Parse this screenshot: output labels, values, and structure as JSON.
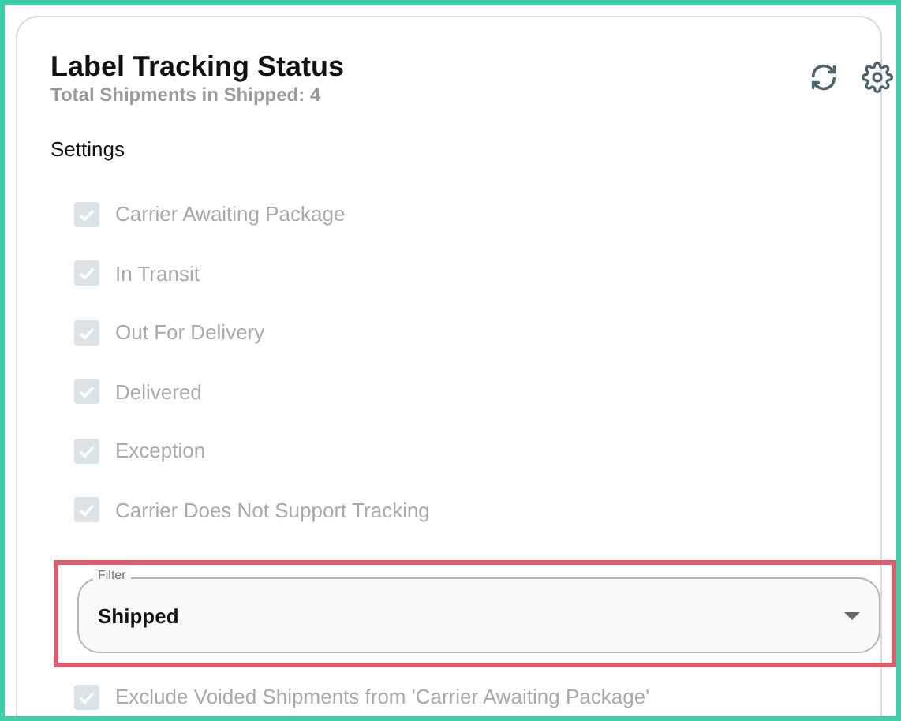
{
  "card": {
    "title": "Label Tracking Status",
    "subtitle": "Total Shipments in Shipped: 4"
  },
  "settings": {
    "heading": "Settings",
    "options": [
      {
        "label": "Carrier Awaiting Package",
        "checked": true,
        "disabled": true
      },
      {
        "label": "In Transit",
        "checked": true,
        "disabled": true
      },
      {
        "label": "Out For Delivery",
        "checked": true,
        "disabled": true
      },
      {
        "label": "Delivered",
        "checked": true,
        "disabled": true
      },
      {
        "label": "Exception",
        "checked": true,
        "disabled": true
      },
      {
        "label": "Carrier Does Not Support Tracking",
        "checked": true,
        "disabled": true
      }
    ]
  },
  "filter": {
    "label": "Filter",
    "value": "Shipped",
    "highlighted": true
  },
  "extra_options": [
    {
      "label": "Exclude Voided Shipments from 'Carrier Awaiting Package'",
      "checked": true,
      "disabled": true
    }
  ]
}
